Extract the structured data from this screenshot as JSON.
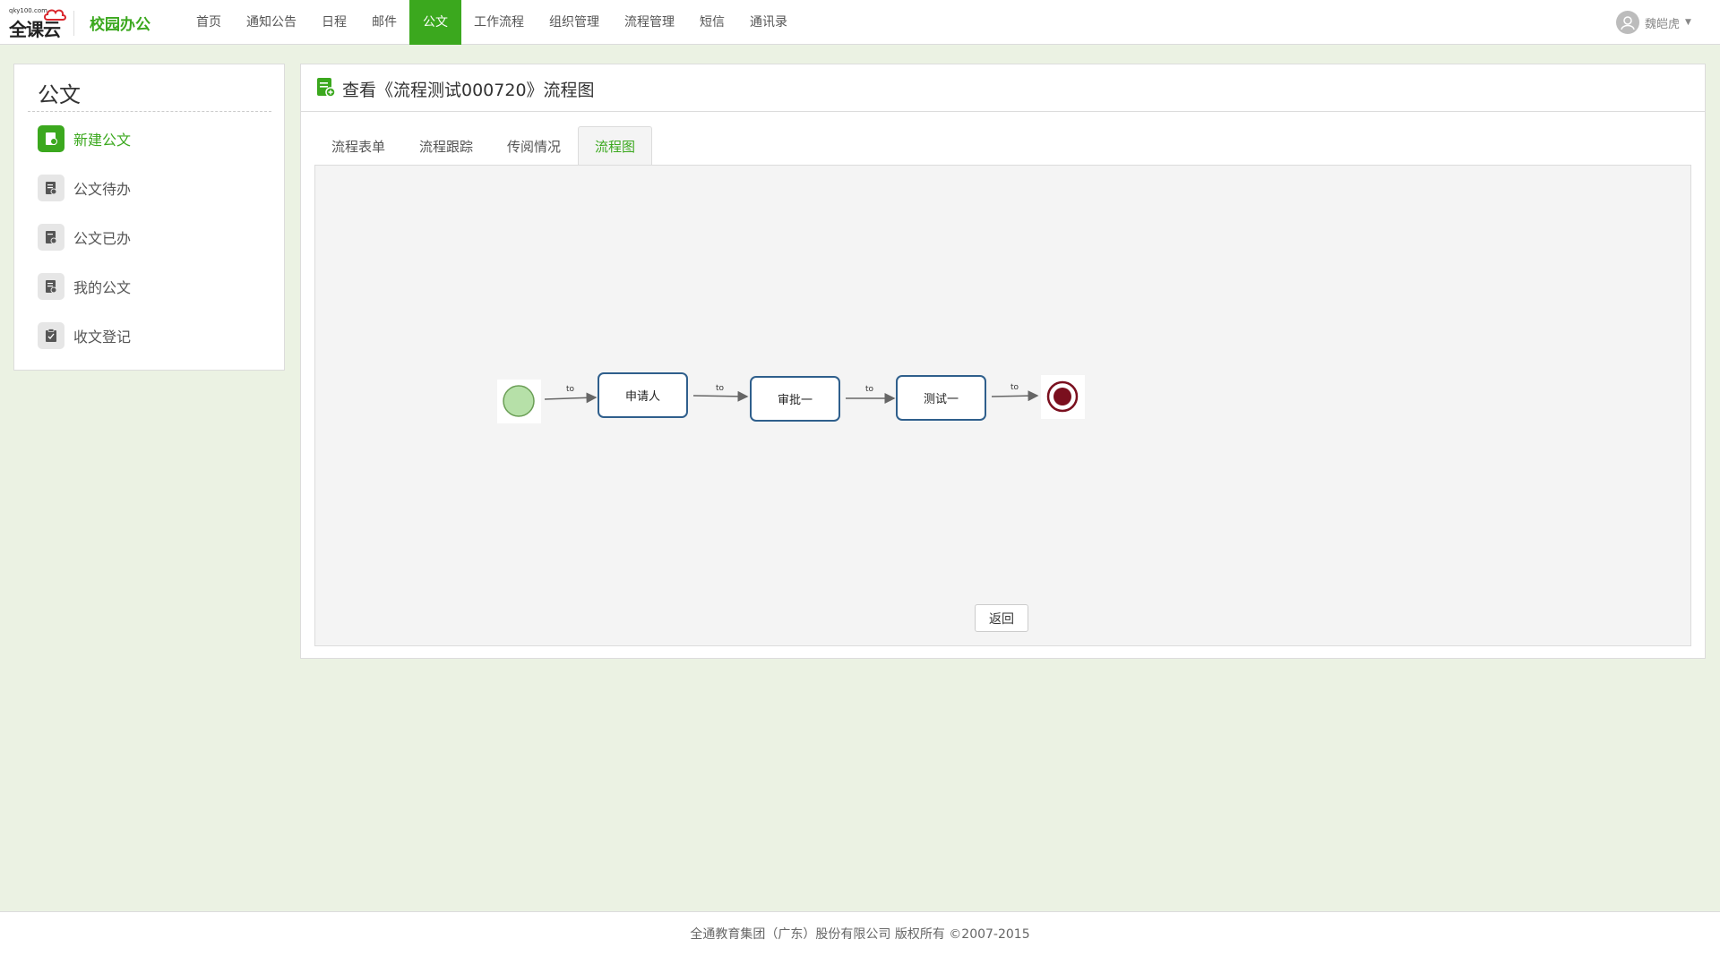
{
  "brand": {
    "logo_small": "qky100.com",
    "logo_text": "全课云",
    "app_title": "校园办公"
  },
  "nav": {
    "items": [
      {
        "label": "首页"
      },
      {
        "label": "通知公告"
      },
      {
        "label": "日程"
      },
      {
        "label": "邮件"
      },
      {
        "label": "公文"
      },
      {
        "label": "工作流程"
      },
      {
        "label": "组织管理"
      },
      {
        "label": "流程管理"
      },
      {
        "label": "短信"
      },
      {
        "label": "通讯录"
      }
    ],
    "active_index": 4
  },
  "user": {
    "name": "魏皑虎"
  },
  "sidebar": {
    "title": "公文",
    "items": [
      {
        "label": "新建公文",
        "icon": "new-doc-icon"
      },
      {
        "label": "公文待办",
        "icon": "doc-pending-icon"
      },
      {
        "label": "公文已办",
        "icon": "doc-done-icon"
      },
      {
        "label": "我的公文",
        "icon": "my-doc-icon"
      },
      {
        "label": "收文登记",
        "icon": "receive-register-icon"
      }
    ]
  },
  "main": {
    "title": "查看《流程测试000720》流程图",
    "tabs": [
      {
        "label": "流程表单"
      },
      {
        "label": "流程跟踪"
      },
      {
        "label": "传阅情况"
      },
      {
        "label": "流程图"
      }
    ],
    "active_tab": 3,
    "back_label": "返回"
  },
  "diagram": {
    "nodes": [
      {
        "label": "申请人"
      },
      {
        "label": "审批一"
      },
      {
        "label": "测试一"
      }
    ],
    "transitions": [
      "to",
      "to",
      "to",
      "to"
    ]
  },
  "footer": {
    "text": "全通教育集团（广东）股份有限公司 版权所有 ©2007-2015"
  },
  "colors": {
    "accent": "#3ba81e",
    "background": "#ebf2e3",
    "task_border": "#2f5f8c",
    "end_event": "#7a0f1e",
    "start_event": "#a8d89a"
  }
}
